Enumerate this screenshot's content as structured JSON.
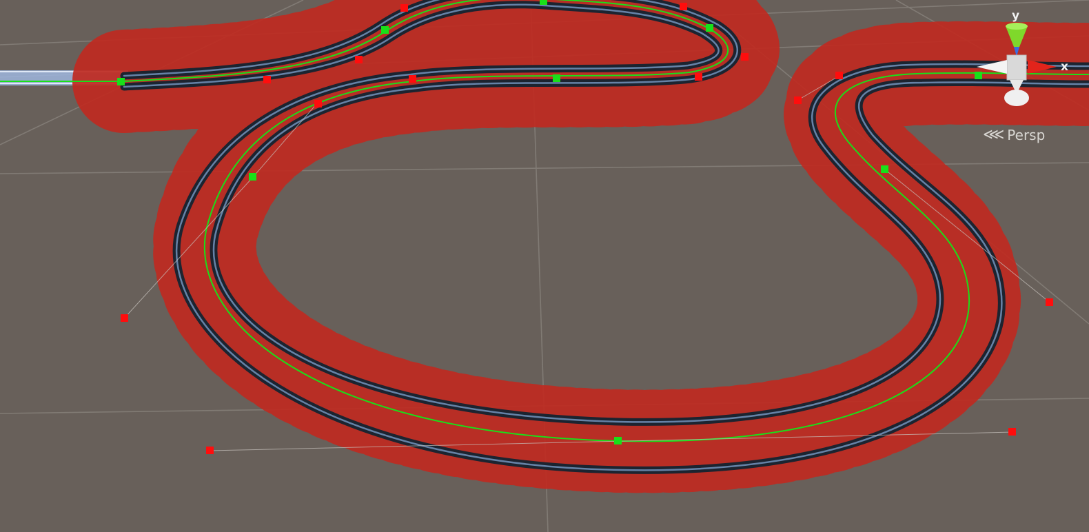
{
  "viewport": {
    "background": "#68605a",
    "grid_color": "#8a847e",
    "rail_color": "#1c2430",
    "rail_highlight": "#6f8db5",
    "sleeper_color": "#c0271f",
    "spline_color": "#19e019",
    "knot_color": "#19e019",
    "handle_color": "#ff0d0d"
  },
  "orientation_gizmo": {
    "y_label": "y",
    "x_label": "x",
    "projection_label": "Persp",
    "y_axis_color": "#7fd82b",
    "x_axis_color": "#e2241b",
    "z_axis_color": "#3a6fe0",
    "neutral_color": "#e8e8e8"
  }
}
